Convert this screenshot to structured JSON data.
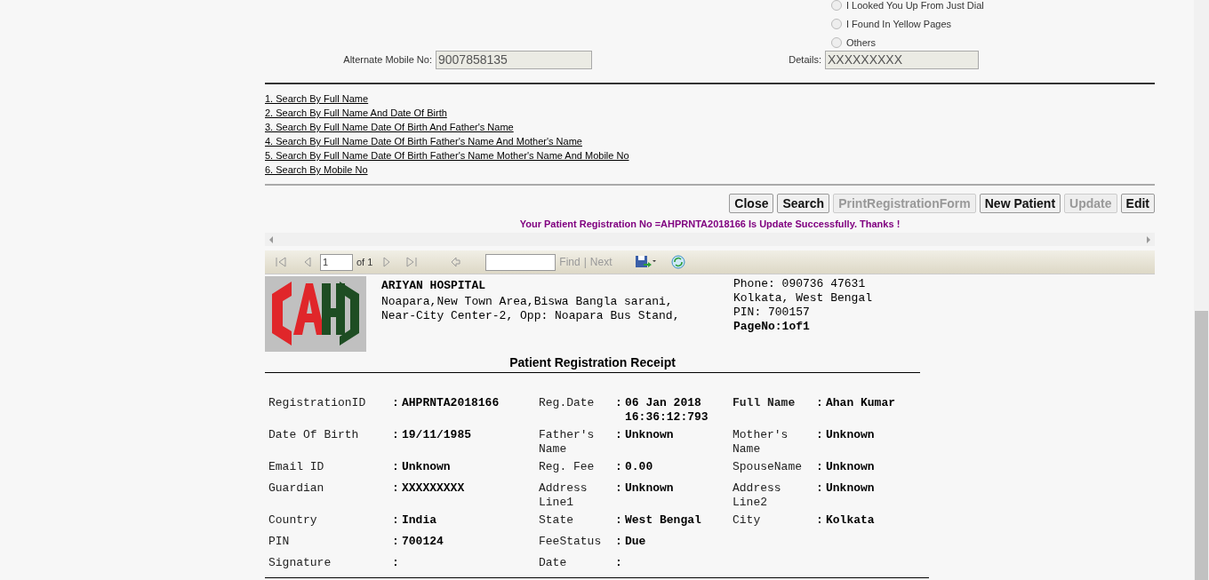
{
  "referral_options": [
    {
      "label": "I Looked You Up From Just Dial",
      "selected": false
    },
    {
      "label": "I Found In Yellow Pages",
      "selected": false
    },
    {
      "label": "Others",
      "selected": false
    }
  ],
  "alternate_mobile": {
    "label": "Alternate Mobile No:",
    "value": "9007858135"
  },
  "details": {
    "label": "Details:",
    "value": "XXXXXXXXX"
  },
  "search_links": [
    "1. Search By Full Name",
    "2. Search By Full Name And Date Of Birth",
    "3. Search By Full Name Date Of Birth And Father's Name",
    "4. Search By Full Name Date Of Birth Father's Name And Mother's Name",
    "5. Search By Full Name Date Of Birth Father's Name Mother's Name And Mobile No",
    "6. Search By Mobile No"
  ],
  "buttons": [
    {
      "label": "Close",
      "disabled": false
    },
    {
      "label": "Search",
      "disabled": false
    },
    {
      "label": "PrintRegistrationForm",
      "disabled": true
    },
    {
      "label": "New Patient",
      "disabled": false
    },
    {
      "label": "Update",
      "disabled": true
    },
    {
      "label": "Edit",
      "disabled": false
    }
  ],
  "message": "Your Patient Registration No =AHPRNTA2018166 Is Update Successfully. Thanks !",
  "report_toolbar": {
    "page": "1",
    "of": "of 1",
    "find": "Find",
    "separator": "|",
    "next": "Next"
  },
  "receipt": {
    "hospital_name": "ARIYAN HOSPITAL",
    "address_lines": [
      "Noapara,New Town Area,Biswa Bangla sarani,",
      "Near-City Center-2, Opp: Noapara Bus Stand,"
    ],
    "contact_lines": [
      "Phone: 090736 47631",
      "Kolkata, West Bengal",
      "PIN: 700157"
    ],
    "page_no": "PageNo:1of1",
    "title": "Patient Registration Receipt",
    "rows": [
      [
        {
          "label": "RegistrationID",
          "bold": false,
          "colon": ":",
          "value": "AHPRNTA2018166"
        },
        {
          "label": "Reg.Date",
          "bold": false,
          "colon": ":",
          "value": "06 Jan 2018 16:36:12:793"
        },
        {
          "label": "Full Name",
          "bold": true,
          "colon": ":",
          "value": "Ahan Kumar"
        }
      ],
      [
        {
          "label": "Date Of Birth",
          "bold": false,
          "colon": ":",
          "value": "19/11/1985"
        },
        {
          "label": "Father's Name",
          "bold": false,
          "colon": ":",
          "value": "Unknown"
        },
        {
          "label": "Mother's Name",
          "bold": false,
          "colon": ":",
          "value": "Unknown"
        }
      ],
      [
        {
          "label": "Email ID",
          "bold": false,
          "colon": ":",
          "value": "Unknown"
        },
        {
          "label": "Reg. Fee",
          "bold": false,
          "colon": ":",
          "value": "0.00"
        },
        {
          "label": "SpouseName",
          "bold": false,
          "colon": ":",
          "value": "Unknown"
        }
      ],
      [
        {
          "label": "Guardian",
          "bold": false,
          "colon": ":",
          "value": "XXXXXXXXX"
        },
        {
          "label": "Address Line1",
          "bold": false,
          "colon": ":",
          "value": "Unknown"
        },
        {
          "label": "Address Line2",
          "bold": false,
          "colon": ":",
          "value": "Unknown"
        }
      ],
      [
        {
          "label": "Country",
          "bold": false,
          "colon": ":",
          "value": "India"
        },
        {
          "label": "State",
          "bold": false,
          "colon": ":",
          "value": "West Bengal"
        },
        {
          "label": "City",
          "bold": false,
          "colon": ":",
          "value": "Kolkata"
        }
      ],
      [
        {
          "label": "PIN",
          "bold": false,
          "colon": ":",
          "value": "700124"
        },
        {
          "label": "FeeStatus",
          "bold": false,
          "colon": ":",
          "value": "Due"
        }
      ],
      [
        {
          "label": "Signature",
          "bold": false,
          "colon": ":"
        },
        {
          "label": "Date",
          "bold": false,
          "colon": ":"
        }
      ]
    ]
  }
}
